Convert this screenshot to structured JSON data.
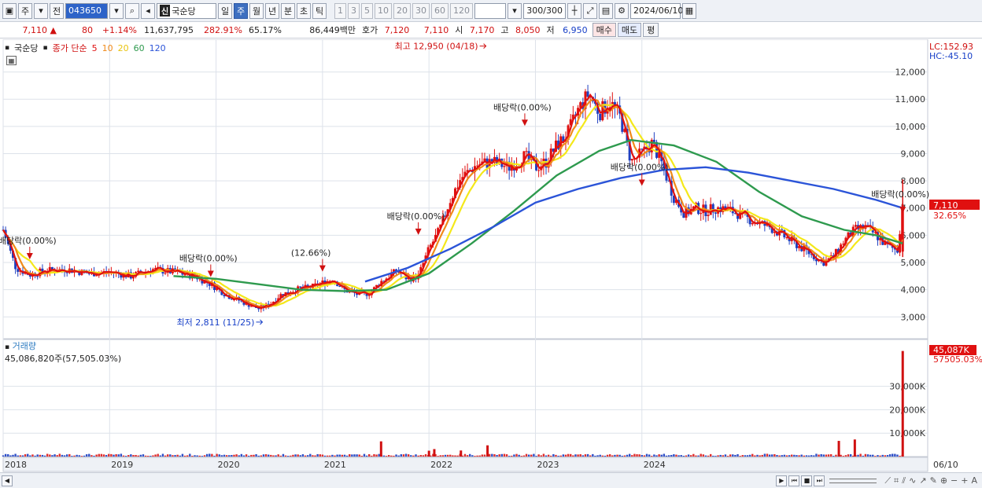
{
  "toolbar": {
    "mode": "주",
    "prev": "전",
    "code": "043650",
    "shin": "신",
    "stock_name": "국순당",
    "periods": [
      "일",
      "주",
      "월",
      "년",
      "분",
      "초",
      "틱"
    ],
    "selected_period": "주",
    "intervals": [
      "1",
      "3",
      "5",
      "10",
      "20",
      "30",
      "60",
      "120"
    ],
    "count": "300",
    "count_total": "/300",
    "date": "2024/06/10"
  },
  "quote": {
    "price": "7,110",
    "arrow": "▲",
    "change": "80",
    "change_pct": "+1.14%",
    "volume": "11,637,795",
    "vol_ratio": "282.91%",
    "turnover": "65.17%",
    "amount": "86,449백만",
    "hoga_label": "호가",
    "ask": "7,120",
    "bid": "7,110",
    "open_label": "시",
    "open": "7,170",
    "high_label": "고",
    "high": "8,050",
    "low_label": "저",
    "low": "6,950",
    "buy_label": "매수",
    "sell_label": "매도",
    "eval_label": "평"
  },
  "legend": {
    "name": "국순당",
    "ma_label": "종가 단순",
    "ma": [
      "5",
      "10",
      "20",
      "60",
      "120"
    ],
    "ma_colors": [
      "#e01010",
      "#f08a1a",
      "#f4e81a",
      "#2e9a4e",
      "#2b54d8"
    ]
  },
  "volume_legend": {
    "title": "거래량",
    "value": "45,086,820주(57,505.03%)"
  },
  "colors": {
    "up": "#e01010",
    "down": "#2040c0",
    "price_tag": "#e01010",
    "grid": "#dde2ea"
  },
  "chart_data": {
    "type": "candlestick",
    "period": "weekly",
    "y_range": [
      2200,
      13200
    ],
    "y_ticks": [
      "12,000",
      "11,000",
      "10,000",
      "9,000",
      "8,000",
      "7,000",
      "6,000",
      "5,000",
      "4,000",
      "3,000"
    ],
    "x_ticks": [
      "2018",
      "2019",
      "2020",
      "2021",
      "2022",
      "2023",
      "2024"
    ],
    "x_end_label": "06/10",
    "corner_lc": "LC:152.93",
    "corner_hc": "HC:-45.10",
    "last_price_tag": "7,110",
    "last_pct_tag": "32.65%",
    "annotations": [
      {
        "text": "배당락(0.00%)"
      },
      {
        "text": "배당락(0.00%)"
      },
      {
        "text": "(12.66%)"
      },
      {
        "text": "배당락(0.00%)"
      },
      {
        "text": "배당락(0.00%)"
      },
      {
        "text": "배당락(0.00%)"
      },
      {
        "text": "배당락(0.00%)"
      }
    ],
    "high_label": "최고 12,950 (04/18)",
    "low_label": "최저 2,811 (11/25)",
    "close_path": [
      [
        2018.0,
        6200
      ],
      [
        2018.05,
        5600
      ],
      [
        2018.12,
        4800
      ],
      [
        2018.25,
        4550
      ],
      [
        2018.4,
        4700
      ],
      [
        2018.6,
        4750
      ],
      [
        2018.8,
        4600
      ],
      [
        2019.0,
        4650
      ],
      [
        2019.2,
        4500
      ],
      [
        2019.4,
        4750
      ],
      [
        2019.6,
        4650
      ],
      [
        2019.8,
        4500
      ],
      [
        2019.95,
        4200
      ],
      [
        2020.1,
        3800
      ],
      [
        2020.25,
        3550
      ],
      [
        2020.4,
        3300
      ],
      [
        2020.5,
        3450
      ],
      [
        2020.6,
        3800
      ],
      [
        2020.75,
        4000
      ],
      [
        2020.9,
        4100
      ],
      [
        2021.0,
        4250
      ],
      [
        2021.1,
        4400
      ],
      [
        2021.2,
        4000
      ],
      [
        2021.35,
        3800
      ],
      [
        2021.45,
        3900
      ],
      [
        2021.55,
        4300
      ],
      [
        2021.7,
        4700
      ],
      [
        2021.8,
        4400
      ],
      [
        2021.9,
        4500
      ],
      [
        2022.0,
        5500
      ],
      [
        2022.1,
        6200
      ],
      [
        2022.2,
        7300
      ],
      [
        2022.3,
        8100
      ],
      [
        2022.45,
        8600
      ],
      [
        2022.6,
        8700
      ],
      [
        2022.75,
        8500
      ],
      [
        2022.9,
        8900
      ],
      [
        2023.0,
        8500
      ],
      [
        2023.1,
        8700
      ],
      [
        2023.2,
        9300
      ],
      [
        2023.3,
        9700
      ],
      [
        2023.4,
        10600
      ],
      [
        2023.5,
        11200
      ],
      [
        2023.6,
        10500
      ],
      [
        2023.7,
        10900
      ],
      [
        2023.8,
        10300
      ],
      [
        2023.9,
        8700
      ],
      [
        2024.0,
        9000
      ],
      [
        2024.1,
        9400
      ],
      [
        2024.2,
        8500
      ],
      [
        2024.3,
        7400
      ],
      [
        2024.4,
        6800
      ],
      [
        2024.5,
        7000
      ],
      [
        2024.6,
        6900
      ],
      [
        2024.7,
        7000
      ],
      [
        2024.8,
        6950
      ],
      [
        2024.9,
        6800
      ],
      [
        2025.0,
        6600
      ],
      [
        2025.2,
        6300
      ],
      [
        2025.4,
        5800
      ],
      [
        2025.55,
        5400
      ],
      [
        2025.7,
        5000
      ],
      [
        2025.8,
        5200
      ],
      [
        2025.9,
        5800
      ],
      [
        2026.0,
        6200
      ],
      [
        2026.1,
        6300
      ],
      [
        2026.2,
        6000
      ],
      [
        2026.3,
        5600
      ],
      [
        2026.4,
        5450
      ],
      [
        2026.45,
        7110
      ]
    ],
    "ma120_path": [
      [
        2021.4,
        4300
      ],
      [
        2021.8,
        4800
      ],
      [
        2022.2,
        5500
      ],
      [
        2022.6,
        6300
      ],
      [
        2023.0,
        7200
      ],
      [
        2023.4,
        7700
      ],
      [
        2023.8,
        8100
      ],
      [
        2024.2,
        8400
      ],
      [
        2024.6,
        8500
      ],
      [
        2025.0,
        8300
      ],
      [
        2025.4,
        8000
      ],
      [
        2025.8,
        7700
      ],
      [
        2026.2,
        7300
      ],
      [
        2026.45,
        7000
      ]
    ],
    "ma60_path": [
      [
        2019.6,
        4500
      ],
      [
        2020.0,
        4400
      ],
      [
        2020.4,
        4200
      ],
      [
        2020.8,
        4000
      ],
      [
        2021.2,
        3950
      ],
      [
        2021.6,
        4000
      ],
      [
        2022.0,
        4600
      ],
      [
        2022.4,
        5700
      ],
      [
        2022.8,
        6900
      ],
      [
        2023.2,
        8200
      ],
      [
        2023.6,
        9100
      ],
      [
        2023.9,
        9500
      ],
      [
        2024.3,
        9300
      ],
      [
        2024.7,
        8700
      ],
      [
        2025.1,
        7600
      ],
      [
        2025.5,
        6700
      ],
      [
        2025.9,
        6200
      ],
      [
        2026.2,
        6000
      ],
      [
        2026.45,
        5700
      ]
    ],
    "volume": {
      "y_ticks": [
        "30,000K",
        "20,000K",
        "10,000K"
      ],
      "tag": "45,087K",
      "tag_pct": "57505.03%",
      "spikes": [
        [
          2021.55,
          6500
        ],
        [
          2022.0,
          2500
        ],
        [
          2022.05,
          3200
        ],
        [
          2022.3,
          2600
        ],
        [
          2022.55,
          4800
        ],
        [
          2025.85,
          6700
        ],
        [
          2026.0,
          7300
        ],
        [
          2026.45,
          45087
        ]
      ]
    }
  }
}
